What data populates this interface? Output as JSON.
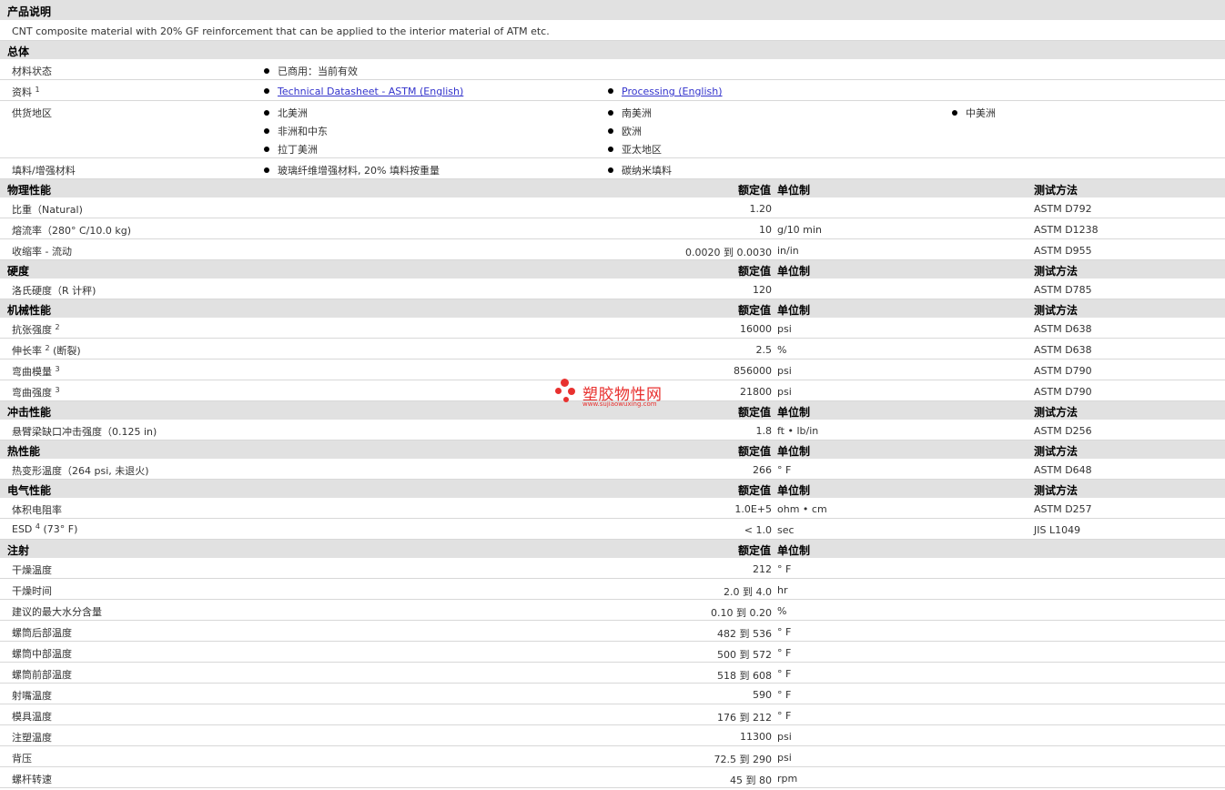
{
  "description_section": {
    "title": "产品说明",
    "text": "CNT composite material with 20% GF reinforcement that can be applied to the interior material of ATM etc."
  },
  "general": {
    "title": "总体",
    "status_label": "材料状态",
    "status_value": "已商用：当前有效",
    "docs_label": "资料",
    "docs_note": "1",
    "docs": [
      "Technical Datasheet - ASTM (English)",
      "Processing (English)"
    ],
    "regions_label": "供货地区",
    "regions": [
      "北美洲",
      "南美洲",
      "中美洲",
      "非洲和中东",
      "欧洲",
      "拉丁美洲",
      "亚太地区"
    ],
    "fillers_label": "填料/增强材料",
    "fillers": [
      "玻璃纤维增强材料, 20% 填料按重量",
      "碳纳米填料"
    ]
  },
  "column_headers": {
    "value": "额定值",
    "unit": "单位制",
    "test": "测试方法"
  },
  "physical": {
    "title": "物理性能",
    "rows": [
      {
        "label": "比重（Natural)",
        "value": "1.20",
        "unit": "",
        "test": "ASTM D792"
      },
      {
        "label": "熔流率（280° C/10.0 kg)",
        "value": "10",
        "unit": "g/10 min",
        "test": "ASTM D1238"
      },
      {
        "label": "收缩率 - 流动",
        "value": "0.0020 到 0.0030",
        "unit": "in/in",
        "test": "ASTM D955"
      }
    ]
  },
  "hardness": {
    "title": "硬度",
    "rows": [
      {
        "label": "洛氏硬度（R 计秤)",
        "value": "120",
        "unit": "",
        "test": "ASTM D785"
      }
    ]
  },
  "mechanical": {
    "title": "机械性能",
    "rows": [
      {
        "label": "抗张强度",
        "note": "2",
        "suffix": "",
        "value": "16000",
        "unit": "psi",
        "test": "ASTM D638"
      },
      {
        "label": "伸长率",
        "note": "2",
        "suffix": "(断裂)",
        "value": "2.5",
        "unit": "%",
        "test": "ASTM D638"
      },
      {
        "label": "弯曲模量",
        "note": "3",
        "suffix": "",
        "value": "856000",
        "unit": "psi",
        "test": "ASTM D790"
      },
      {
        "label": "弯曲强度",
        "note": "3",
        "suffix": "",
        "value": "21800",
        "unit": "psi",
        "test": "ASTM D790"
      }
    ]
  },
  "impact": {
    "title": "冲击性能",
    "rows": [
      {
        "label": "悬臂梁缺口冲击强度（0.125 in)",
        "value": "1.8",
        "unit": "ft • lb/in",
        "test": "ASTM D256"
      }
    ]
  },
  "thermal": {
    "title": "热性能",
    "rows": [
      {
        "label": "热变形温度（264 psi, 未退火)",
        "value": "266",
        "unit": "° F",
        "test": "ASTM D648"
      }
    ]
  },
  "electrical": {
    "title": "电气性能",
    "rows": [
      {
        "label": "体积电阻率",
        "value": "1.0E+5",
        "unit": "ohm • cm",
        "test": "ASTM D257"
      },
      {
        "label": "ESD",
        "note": "4",
        "suffix": "(73° F)",
        "value": "< 1.0",
        "unit": "sec",
        "test": "JIS L1049"
      }
    ]
  },
  "injection": {
    "title": "注射",
    "rows": [
      {
        "label": "干燥温度",
        "value": "212",
        "unit": "° F"
      },
      {
        "label": "干燥时间",
        "value": "2.0 到 4.0",
        "unit": "hr"
      },
      {
        "label": "建议的最大水分含量",
        "value": "0.10 到 0.20",
        "unit": "%"
      },
      {
        "label": "螺筒后部温度",
        "value": "482 到 536",
        "unit": "° F"
      },
      {
        "label": "螺筒中部温度",
        "value": "500 到 572",
        "unit": "° F"
      },
      {
        "label": "螺筒前部温度",
        "value": "518 到 608",
        "unit": "° F"
      },
      {
        "label": "射嘴温度",
        "value": "590",
        "unit": "° F"
      },
      {
        "label": "模具温度",
        "value": "176 到 212",
        "unit": "° F"
      },
      {
        "label": "注塑温度",
        "value": "11300",
        "unit": "psi"
      },
      {
        "label": "背压",
        "value": "72.5 到 290",
        "unit": "psi"
      },
      {
        "label": "螺杆转速",
        "value": "45 到 80",
        "unit": "rpm"
      }
    ]
  },
  "watermark": {
    "text": "塑胶物性网",
    "url": "www.sujiaowuxing.com",
    "color": "#e8312f"
  }
}
